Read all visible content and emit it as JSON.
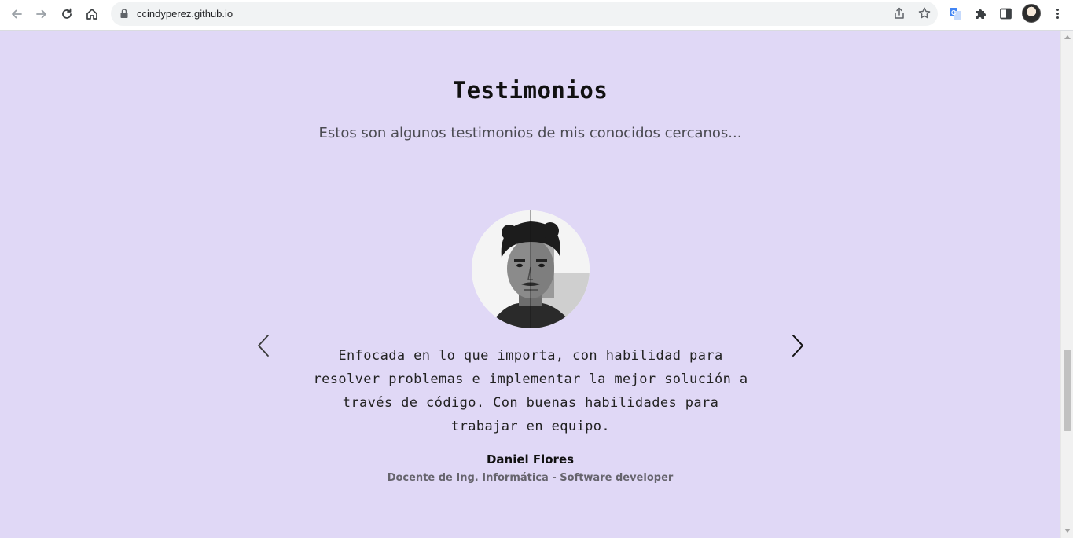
{
  "browser": {
    "url": "ccindyperez.github.io",
    "icons": {
      "back": "back-arrow-icon",
      "forward": "forward-arrow-icon",
      "reload": "reload-icon",
      "home": "home-icon",
      "lock": "lock-icon",
      "share": "share-icon",
      "bookmark": "star-icon",
      "translate": "google-translate-icon",
      "extensions": "puzzle-icon",
      "side_panel": "side-panel-icon",
      "menu": "kebab-menu-icon"
    }
  },
  "testimonials": {
    "title": "Testimonios",
    "subtitle": "Estos son algunos testimonios de mis conocidos cercanos...",
    "background_color": "#e0d8f6",
    "current": {
      "quote": "Enfocada en lo que importa, con habilidad para resolver problemas e implementar la mejor solución a través de código. Con buenas habilidades para trabajar en equipo.",
      "name": "Daniel Flores",
      "role": "Docente de Ing. Informática - Software developer"
    },
    "controls": {
      "prev_icon": "chevron-left-icon",
      "next_icon": "chevron-right-icon"
    }
  }
}
